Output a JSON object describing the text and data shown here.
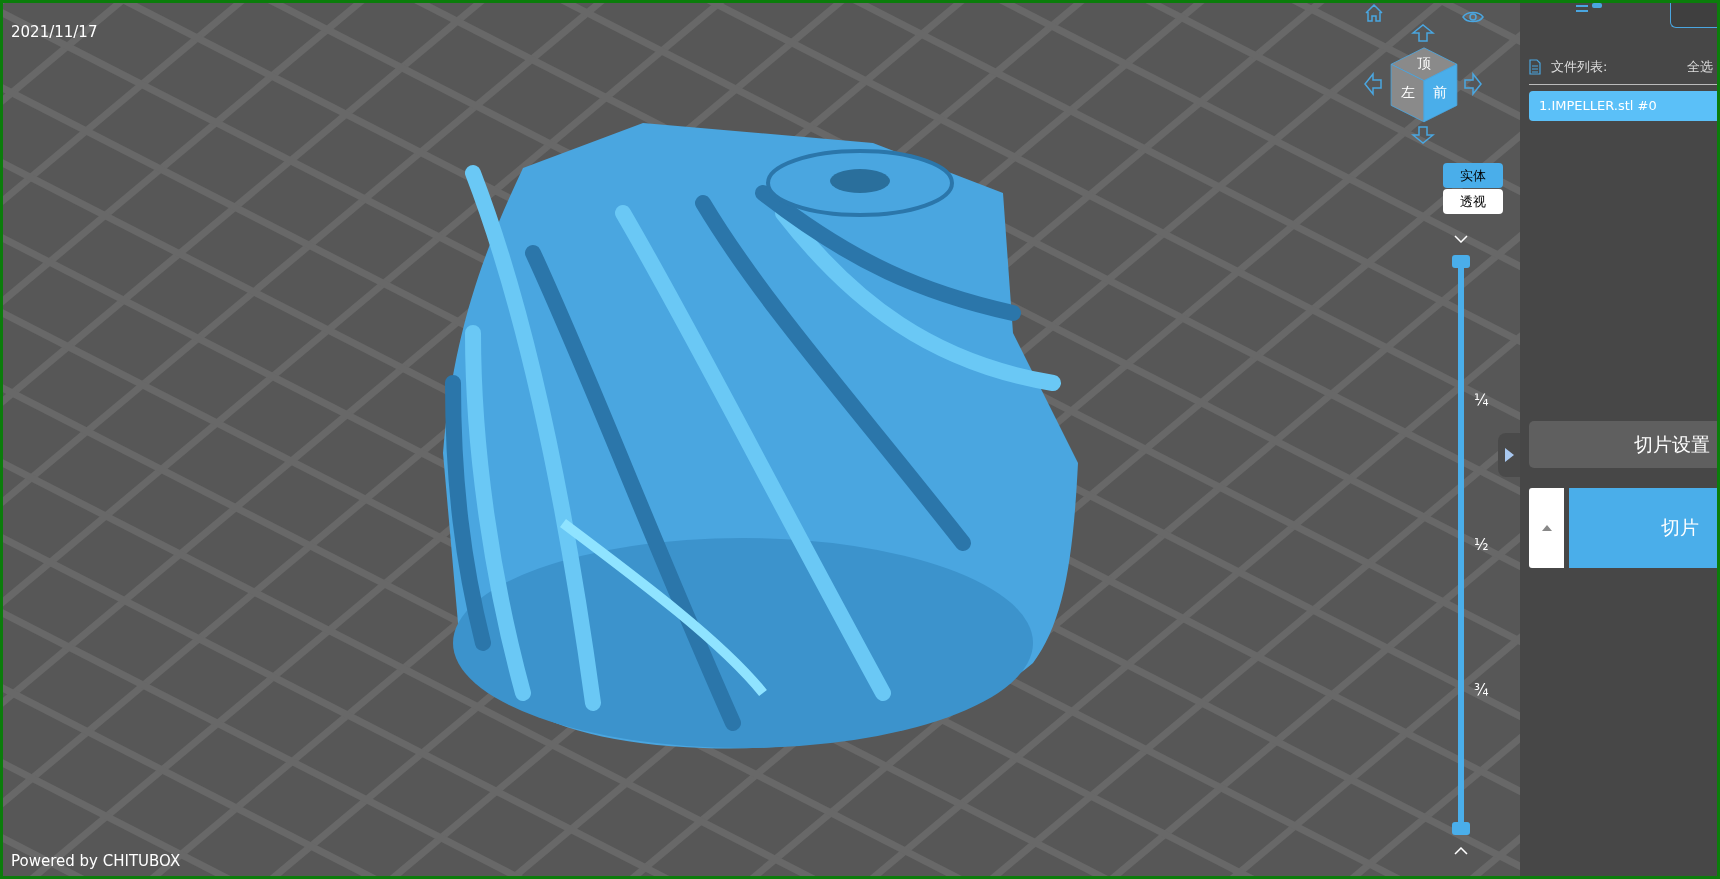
{
  "viewport": {
    "date": "2021/11/17",
    "credit": "Powered by CHITUBOX"
  },
  "view_cube": {
    "faces": [
      {
        "label": "顶",
        "selected": false
      },
      {
        "label": "左",
        "selected": false
      },
      {
        "label": "前",
        "selected": true
      }
    ]
  },
  "view_modes": [
    {
      "label": "实体",
      "selected": true
    },
    {
      "label": "透视",
      "selected": false
    }
  ],
  "layer_slider": {
    "level": 1,
    "ticks": [
      "¼",
      "½",
      "¾"
    ]
  },
  "sidebar": {
    "file_list_label": "文件列表:",
    "select_all": "全选",
    "files": [
      {
        "name": "1.IMPELLER.stl #0",
        "selected": true
      }
    ],
    "slice_settings": "切片设置",
    "slice": "切片"
  }
}
